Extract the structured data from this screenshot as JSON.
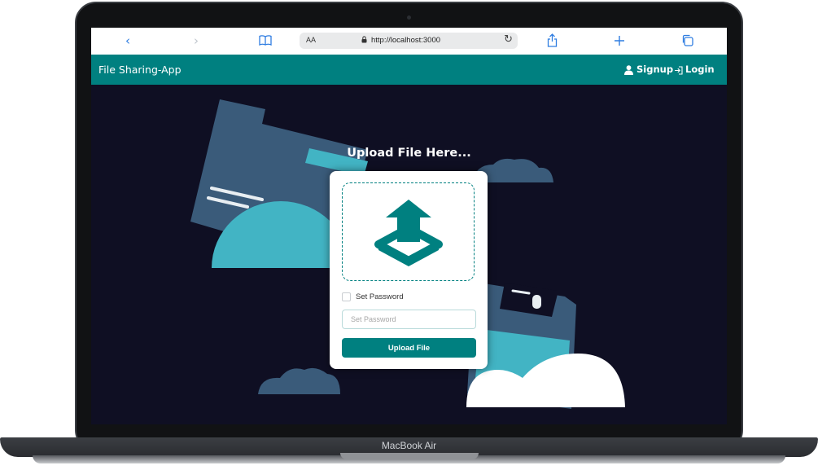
{
  "browser": {
    "text_size_label": "AA",
    "url": "http://localhost:3000"
  },
  "navbar": {
    "brand": "File Sharing-App",
    "signup_label": "Signup",
    "login_label": "Login"
  },
  "main": {
    "title": "Upload File Here...",
    "set_password_label": "Set Password",
    "password_placeholder": "Set Password",
    "upload_button_label": "Upload File"
  },
  "device": {
    "model": "MacBook Air"
  },
  "colors": {
    "primary": "#008080",
    "background": "#0f0f23",
    "illustration_dark": "#3a5b7a",
    "illustration_light": "#42b4c4"
  },
  "icons": {
    "back": "chevron-left-icon",
    "forward": "chevron-right-icon",
    "bookmarks": "book-icon",
    "share": "share-icon",
    "new_tab": "plus-icon",
    "tabs": "tabs-icon",
    "signup": "user-icon",
    "login": "login-icon",
    "upload": "upload-tray-icon"
  }
}
